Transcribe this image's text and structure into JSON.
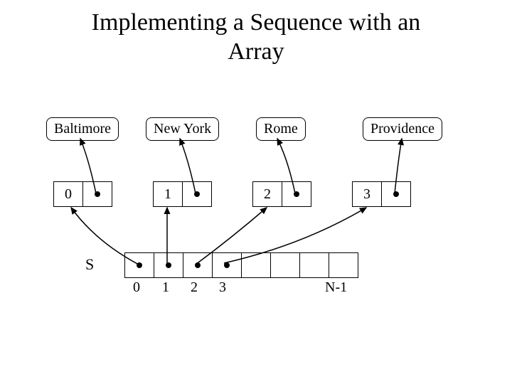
{
  "title_line1": "Implementing a Sequence with an",
  "title_line2": "Array",
  "cities": {
    "c0": "Baltimore",
    "c1": "New York",
    "c2": "Rome",
    "c3": "Providence"
  },
  "positions": {
    "p0": "0",
    "p1": "1",
    "p2": "2",
    "p3": "3"
  },
  "s_label": "S",
  "array_indices": {
    "i0": "0",
    "i1": "1",
    "i2": "2",
    "i3": "3",
    "iN": "N-1"
  }
}
